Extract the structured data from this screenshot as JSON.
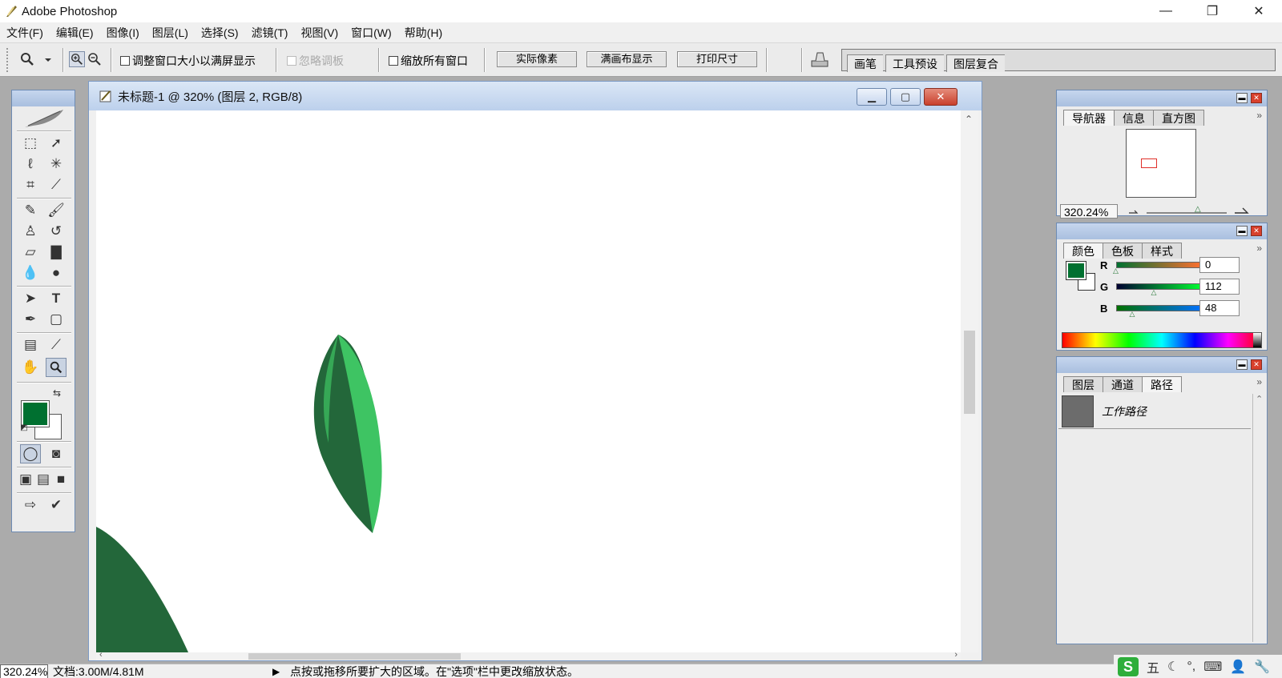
{
  "app": {
    "title": "Adobe Photoshop",
    "window_controls": {
      "minimize": "—",
      "restore": "❐",
      "close": "✕"
    }
  },
  "menu": [
    "文件(F)",
    "编辑(E)",
    "图像(I)",
    "图层(L)",
    "选择(S)",
    "滤镜(T)",
    "视图(V)",
    "窗口(W)",
    "帮助(H)"
  ],
  "options": {
    "resize_windows_label": "调整窗口大小以满屏显示",
    "ignore_palettes_label": "忽略调板",
    "zoom_all_label": "缩放所有窗口",
    "actual_pixels_label": "实际像素",
    "fit_screen_label": "满画布显示",
    "print_size_label": "打印尺寸",
    "well_tabs": [
      "画笔",
      "工具预设",
      "图层复合"
    ]
  },
  "document": {
    "title": "未标题-1 @ 320% (图层 2, RGB/8)"
  },
  "colors": {
    "foreground": "#007030",
    "background": "#ffffff",
    "leaf_dark": "#23673a",
    "leaf_light": "#3ec463"
  },
  "navigator": {
    "tabs": [
      "导航器",
      "信息",
      "直方图"
    ],
    "zoom": "320.24%"
  },
  "color_panel": {
    "tabs": [
      "颜色",
      "色板",
      "样式"
    ],
    "r_label": "R",
    "r_value": "0",
    "r_level": 0,
    "g_label": "G",
    "g_value": "112",
    "g_level": 0.44,
    "b_label": "B",
    "b_value": "48",
    "b_level": 0.19
  },
  "layers_panel": {
    "tabs": [
      "图层",
      "通道",
      "路径"
    ],
    "path_name": "工作路径"
  },
  "status": {
    "zoom": "320.24%",
    "doc_size": "文档:3.00M/4.81M",
    "hint": "点按或拖移所要扩大的区域。在\"选项\"栏中更改缩放状态。"
  },
  "ime": {
    "logo": "S",
    "mode": "五"
  }
}
